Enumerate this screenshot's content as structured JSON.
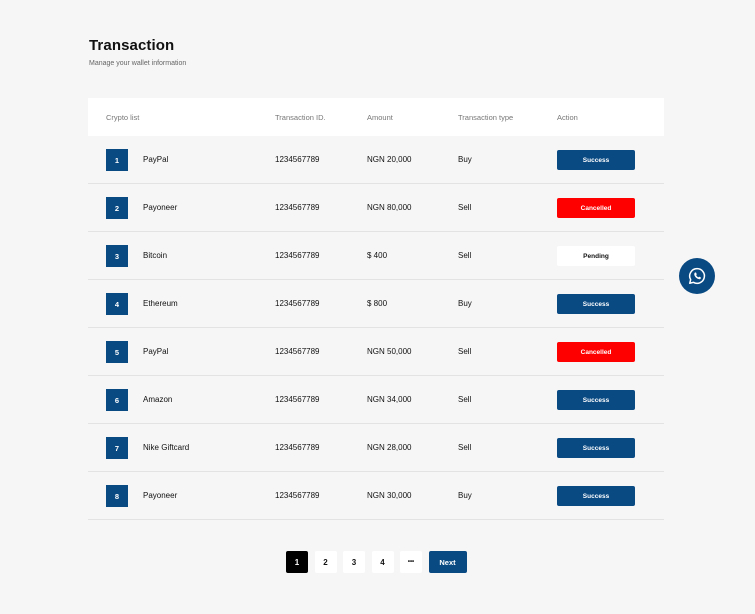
{
  "page": {
    "title": "Transaction",
    "subtitle": "Manage your wallet information"
  },
  "table": {
    "headers": {
      "crypto": "Crypto list",
      "id": "Transaction ID.",
      "amount": "Amount",
      "type": "Transaction type",
      "action": "Action"
    },
    "rows": [
      {
        "num": "1",
        "name": "PayPal",
        "id": "1234567789",
        "amount": "NGN 20,000",
        "type": "Buy",
        "status": "Success",
        "status_kind": "success"
      },
      {
        "num": "2",
        "name": "Payoneer",
        "id": "1234567789",
        "amount": "NGN 80,000",
        "type": "Sell",
        "status": "Cancelled",
        "status_kind": "cancelled"
      },
      {
        "num": "3",
        "name": "Bitcoin",
        "id": "1234567789",
        "amount": "$ 400",
        "type": "Sell",
        "status": "Pending",
        "status_kind": "pending"
      },
      {
        "num": "4",
        "name": "Ethereum",
        "id": "1234567789",
        "amount": "$ 800",
        "type": "Buy",
        "status": "Success",
        "status_kind": "success"
      },
      {
        "num": "5",
        "name": "PayPal",
        "id": "1234567789",
        "amount": "NGN 50,000",
        "type": "Sell",
        "status": "Cancelled",
        "status_kind": "cancelled"
      },
      {
        "num": "6",
        "name": "Amazon",
        "id": "1234567789",
        "amount": "NGN 34,000",
        "type": "Sell",
        "status": "Success",
        "status_kind": "success"
      },
      {
        "num": "7",
        "name": "Nike Giftcard",
        "id": "1234567789",
        "amount": "NGN 28,000",
        "type": "Sell",
        "status": "Success",
        "status_kind": "success"
      },
      {
        "num": "8",
        "name": "Payoneer",
        "id": "1234567789",
        "amount": "NGN 30,000",
        "type": "Buy",
        "status": "Success",
        "status_kind": "success"
      }
    ]
  },
  "pagination": {
    "pages": [
      "1",
      "2",
      "3",
      "4"
    ],
    "ellipsis": "•••",
    "next_label": "Next",
    "current": "1"
  },
  "colors": {
    "brand": "#094a83",
    "cancelled": "#ff0000"
  },
  "floating": {
    "icon": "whatsapp-icon"
  }
}
